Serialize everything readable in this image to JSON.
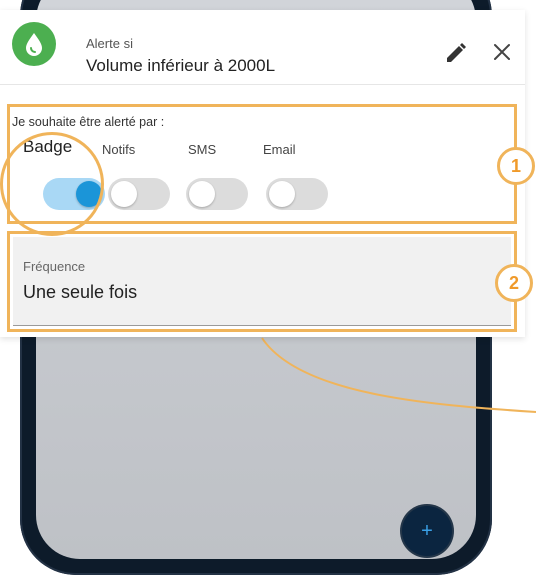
{
  "alert": {
    "label": "Alerte si",
    "value": "Volume inférieur à 2000L",
    "icon": "water-drop-icon",
    "icon_color": "#4caf50"
  },
  "notifications": {
    "prompt": "Je souhaite être alerté par :",
    "channels": [
      {
        "label": "Badge",
        "on": true
      },
      {
        "label": "Notifs",
        "on": false
      },
      {
        "label": "SMS",
        "on": false
      },
      {
        "label": "Email",
        "on": false
      }
    ]
  },
  "frequency": {
    "label": "Fréquence",
    "value": "Une seule fois"
  },
  "callouts": [
    "1",
    "2"
  ],
  "fab": {
    "label": "+"
  },
  "colors": {
    "highlight": "#f0b45a",
    "toggle_on": "#1b95d8",
    "phone": "#0d1b2a"
  }
}
